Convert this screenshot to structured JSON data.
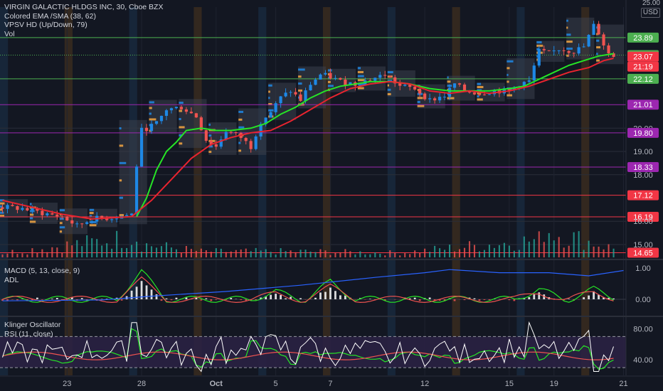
{
  "header": {
    "symbol_line": "VIRGIN GALACTIC HLDGS INC, 30, Cboe BZX",
    "ema_line": "Colored EMA /SMA (38, 62)",
    "vpsv_line": "VPSV HD (Up/Down, 79)",
    "vol_line": "Vol",
    "macd_line": "MACD (5, 13, close, 9)",
    "adl_line": "ADL",
    "klinger_line": "Klinger Oscillator",
    "rsi_line": "RSI (11, close)",
    "currency_top": "25.00",
    "currency": "USD"
  },
  "colors": {
    "background": "#131722",
    "green_line": "#4caf50",
    "red_line": "#f23645",
    "purple_line": "#9c27b0",
    "ema_green": "#26e526",
    "sma_red": "#e8242f",
    "adl_blue": "#2962ff",
    "rsi_white": "#ffffff",
    "rsi_band": "#7e57c2",
    "rsi_band_fill": "#2a2143",
    "profile_blue": "#1e88e5",
    "profile_orange": "#f5a742",
    "session_blue": "#1c3a57",
    "session_orange": "#5a3d1d"
  },
  "chart_data": [
    {
      "type": "candlestick",
      "title": "VIRGIN GALACTIC HLDGS INC, 30, Cboe BZX",
      "ylabel": "USD",
      "ylim": [
        14.45,
        25.2
      ],
      "y_ticks": [
        {
          "value": 25.0,
          "label": ""
        },
        {
          "value": 23.89,
          "label": "23.89",
          "color": "#4caf50"
        },
        {
          "value": 23.14,
          "label": "23.14",
          "color": "#4caf50"
        },
        {
          "value": 23.07,
          "label": "23.07",
          "color": "#f23645"
        },
        {
          "value": 22.12,
          "label": "22.12",
          "color": "#4caf50"
        },
        {
          "value": 21.01,
          "label": "21.01",
          "color": "#9c27b0"
        },
        {
          "value": 20.0,
          "label": "20.00",
          "color": null
        },
        {
          "value": 19.8,
          "label": "19.80",
          "color": "#9c27b0"
        },
        {
          "value": 19.0,
          "label": "19.00",
          "color": null
        },
        {
          "value": 18.33,
          "label": "18.33",
          "color": "#9c27b0"
        },
        {
          "value": 18.0,
          "label": "18.00",
          "color": null
        },
        {
          "value": 17.12,
          "label": "17.12",
          "color": "#f23645"
        },
        {
          "value": 16.19,
          "label": "16.19",
          "color": "#f23645"
        },
        {
          "value": 16.0,
          "label": "16.00",
          "color": null
        },
        {
          "value": 15.0,
          "label": "15.00",
          "color": null
        },
        {
          "value": 14.65,
          "label": "14.65",
          "color": "#f23645"
        }
      ],
      "countdown_label": "21:19",
      "horizontal_levels": [
        {
          "value": 23.89,
          "color": "#4caf50"
        },
        {
          "value": 23.14,
          "color": "#4caf50",
          "style": "dotted"
        },
        {
          "value": 22.12,
          "color": "#4caf50"
        },
        {
          "value": 21.01,
          "color": "#9c27b0"
        },
        {
          "value": 19.8,
          "color": "#9c27b0"
        },
        {
          "value": 18.33,
          "color": "#9c27b0"
        },
        {
          "value": 17.12,
          "color": "#f23645"
        },
        {
          "value": 16.19,
          "color": "#f23645"
        },
        {
          "value": 14.65,
          "color": "#f23645"
        }
      ],
      "x_labels": [
        {
          "label": "23",
          "bar": 13
        },
        {
          "label": "28",
          "bar": 28
        },
        {
          "label": "Oct",
          "bar": 43
        },
        {
          "label": "5",
          "bar": 55
        },
        {
          "label": "7",
          "bar": 66
        },
        {
          "label": "12",
          "bar": 85
        },
        {
          "label": "15",
          "bar": 102
        },
        {
          "label": "19",
          "bar": 111
        },
        {
          "label": "21",
          "bar": 125
        }
      ],
      "bars_total": 126,
      "price_path": [
        [
          0,
          16.6
        ],
        [
          4,
          16.55
        ],
        [
          8,
          16.35
        ],
        [
          12,
          16.2
        ],
        [
          15,
          15.8
        ],
        [
          18,
          16.1
        ],
        [
          22,
          16.15
        ],
        [
          26,
          16.3
        ],
        [
          27,
          18.4
        ],
        [
          28,
          19.9
        ],
        [
          31,
          20.2
        ],
        [
          33,
          20.8
        ],
        [
          36,
          20.9
        ],
        [
          39,
          20.5
        ],
        [
          41,
          19.5
        ],
        [
          43,
          19.2
        ],
        [
          45,
          19.9
        ],
        [
          48,
          19.6
        ],
        [
          50,
          19.2
        ],
        [
          52,
          20.3
        ],
        [
          54,
          20.7
        ],
        [
          56,
          21.3
        ],
        [
          58,
          21.6
        ],
        [
          60,
          21.2
        ],
        [
          62,
          21.9
        ],
        [
          64,
          22.3
        ],
        [
          66,
          22.2
        ],
        [
          68,
          22.0
        ],
        [
          71,
          21.9
        ],
        [
          74,
          22.1
        ],
        [
          77,
          22.3
        ],
        [
          80,
          21.8
        ],
        [
          83,
          21.7
        ],
        [
          86,
          21.2
        ],
        [
          89,
          21.4
        ],
        [
          91,
          21.9
        ],
        [
          93,
          21.6
        ],
        [
          96,
          21.5
        ],
        [
          99,
          21.6
        ],
        [
          102,
          21.6
        ],
        [
          104,
          21.9
        ],
        [
          106,
          22.0
        ],
        [
          108,
          23.3
        ],
        [
          110,
          23.2
        ],
        [
          112,
          23.4
        ],
        [
          115,
          23.3
        ],
        [
          117,
          23.5
        ],
        [
          119,
          24.4
        ],
        [
          120,
          24.1
        ],
        [
          121,
          23.6
        ],
        [
          122,
          23.2
        ],
        [
          123,
          23.1
        ]
      ],
      "series": [
        {
          "name": "Colored EMA",
          "color": "#26e526",
          "points": [
            [
              27,
              16.2
            ],
            [
              29,
              17.0
            ],
            [
              31,
              18.2
            ],
            [
              33,
              19.0
            ],
            [
              35,
              19.4
            ],
            [
              37,
              19.9
            ],
            [
              40,
              20.0
            ],
            [
              43,
              19.9
            ],
            [
              46,
              19.9
            ],
            [
              50,
              20.0
            ],
            [
              53,
              20.2
            ],
            [
              56,
              20.6
            ],
            [
              59,
              20.9
            ],
            [
              62,
              21.3
            ],
            [
              65,
              21.6
            ],
            [
              68,
              21.8
            ],
            [
              71,
              21.9
            ],
            [
              74,
              22.0
            ],
            [
              78,
              22.0
            ],
            [
              82,
              21.9
            ],
            [
              86,
              21.7
            ],
            [
              90,
              21.6
            ],
            [
              94,
              21.6
            ],
            [
              98,
              21.6
            ],
            [
              102,
              21.7
            ],
            [
              105,
              21.8
            ],
            [
              108,
              22.1
            ],
            [
              111,
              22.4
            ],
            [
              114,
              22.7
            ],
            [
              117,
              22.9
            ],
            [
              120,
              23.1
            ],
            [
              123,
              23.2
            ]
          ]
        },
        {
          "name": "SMA",
          "color": "#e8242f",
          "points": [
            [
              0,
              16.9
            ],
            [
              6,
              16.6
            ],
            [
              12,
              16.3
            ],
            [
              18,
              16.1
            ],
            [
              26,
              16.2
            ],
            [
              30,
              16.9
            ],
            [
              34,
              17.8
            ],
            [
              38,
              18.7
            ],
            [
              42,
              19.3
            ],
            [
              46,
              19.6
            ],
            [
              50,
              19.8
            ],
            [
              54,
              19.9
            ],
            [
              58,
              20.3
            ],
            [
              62,
              20.8
            ],
            [
              66,
              21.3
            ],
            [
              70,
              21.7
            ],
            [
              74,
              21.9
            ],
            [
              78,
              22.0
            ],
            [
              82,
              21.9
            ],
            [
              86,
              21.6
            ],
            [
              90,
              21.5
            ],
            [
              94,
              21.6
            ],
            [
              98,
              21.5
            ],
            [
              102,
              21.6
            ],
            [
              106,
              21.8
            ],
            [
              110,
              22.1
            ],
            [
              114,
              22.4
            ],
            [
              118,
              22.6
            ],
            [
              121,
              22.9
            ],
            [
              123,
              23.0
            ]
          ]
        }
      ]
    },
    {
      "type": "bar",
      "title": "Vol",
      "volume_path": [
        [
          0,
          0.15
        ],
        [
          27,
          0.7
        ],
        [
          28,
          0.45
        ],
        [
          40,
          0.2
        ],
        [
          60,
          0.2
        ],
        [
          80,
          0.15
        ],
        [
          108,
          0.6
        ],
        [
          109,
          1.0
        ],
        [
          112,
          0.8
        ],
        [
          119,
          0.5
        ],
        [
          123,
          0.3
        ]
      ]
    },
    {
      "type": "line",
      "title": "MACD (5, 13, close, 9)",
      "zero_label": "0.00",
      "top_label": "1.00",
      "series": [
        {
          "name": "ADL",
          "color": "#2962ff",
          "points": [
            [
              0,
              -0.05
            ],
            [
              20,
              -0.02
            ],
            [
              30,
              0.1
            ],
            [
              45,
              0.25
            ],
            [
              60,
              0.45
            ],
            [
              75,
              0.7
            ],
            [
              85,
              0.85
            ],
            [
              90,
              0.95
            ],
            [
              100,
              0.85
            ],
            [
              110,
              0.85
            ],
            [
              118,
              0.75
            ],
            [
              125,
              0.92
            ]
          ]
        }
      ],
      "macd_peaks": [
        [
          28,
          0.55
        ],
        [
          55,
          0.15
        ],
        [
          66,
          0.35
        ],
        [
          108,
          0.2
        ],
        [
          119,
          0.2
        ]
      ]
    },
    {
      "type": "line",
      "title": "RSI (11, close)",
      "ylim": [
        20,
        95
      ],
      "y_ticks": [
        {
          "value": 80,
          "label": "80.00"
        },
        {
          "value": 40,
          "label": "40.00"
        }
      ],
      "band": [
        30,
        70
      ]
    }
  ]
}
